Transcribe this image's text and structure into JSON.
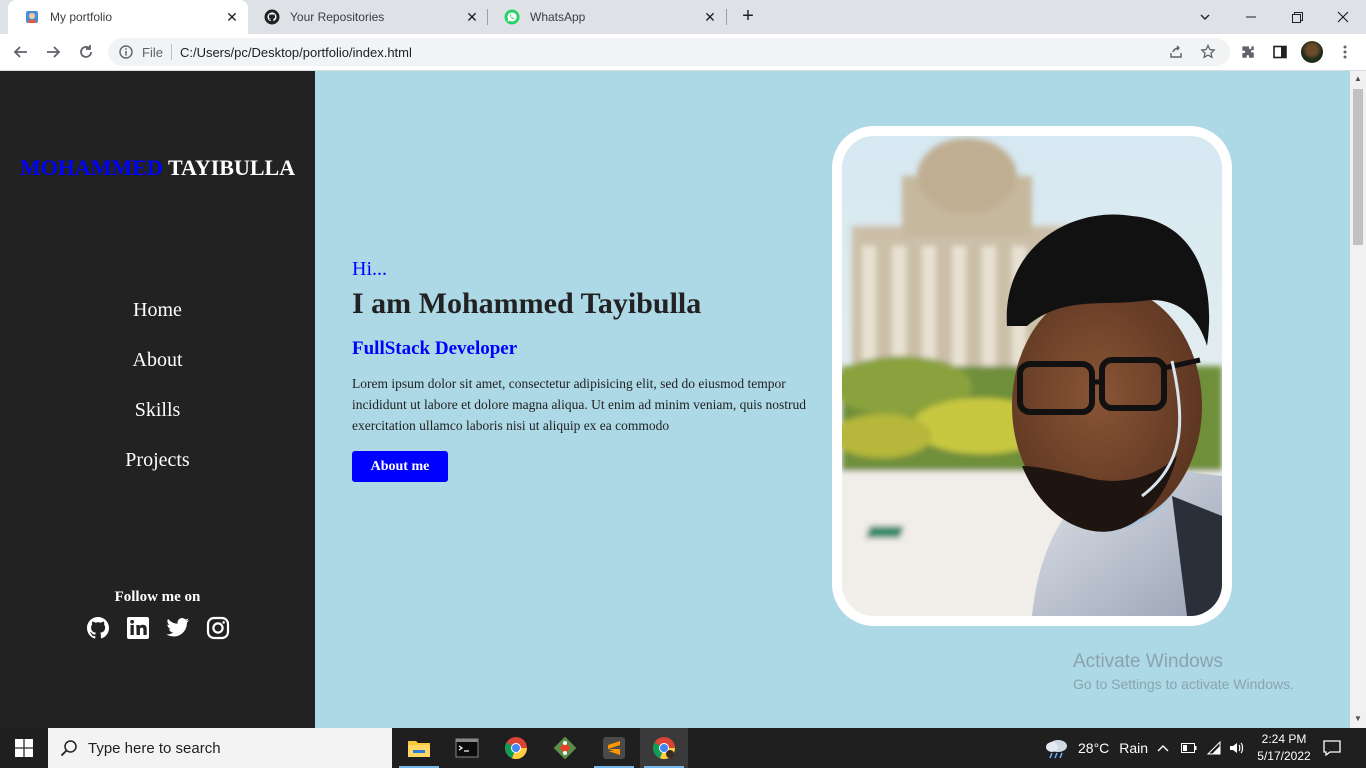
{
  "browser": {
    "tabs": [
      {
        "title": "My portfolio",
        "icon": "portfolio-favicon",
        "active": true
      },
      {
        "title": "Your Repositories",
        "icon": "github-favicon",
        "active": false
      },
      {
        "title": "WhatsApp",
        "icon": "whatsapp-favicon",
        "active": false
      }
    ],
    "address": {
      "scheme_label": "File",
      "url": "C:/Users/pc/Desktop/portfolio/index.html"
    }
  },
  "sidebar": {
    "brand_first": "MOHAMMED",
    "brand_last": "TAYIBULLA",
    "nav": [
      {
        "label": "Home"
      },
      {
        "label": "About"
      },
      {
        "label": "Skills"
      },
      {
        "label": "Projects"
      }
    ],
    "follow_label": "Follow me on",
    "socials": [
      "github-icon",
      "linkedin-icon",
      "twitter-icon",
      "instagram-icon"
    ]
  },
  "hero": {
    "greeting": "Hi...",
    "headline": "I am Mohammed Tayibulla",
    "role": "FullStack Developer",
    "description": "Lorem ipsum dolor sit amet, consectetur adipisicing elit, sed do eiusmod tempor incididunt ut labore et dolore magna aliqua. Ut enim ad minim veniam, quis nostrud exercitation ullamco laboris nisi ut aliquip ex ea commodo",
    "button_label": "About me"
  },
  "watermark": {
    "line1": "Activate Windows",
    "line2": "Go to Settings to activate Windows."
  },
  "taskbar": {
    "search_placeholder": "Type here to search",
    "weather_temp": "28°C",
    "weather_text": "Rain",
    "time": "2:24 PM",
    "date": "5/17/2022"
  },
  "colors": {
    "page_bg": "#add8e6",
    "sidebar_bg": "#222222",
    "accent": "#0000ff"
  }
}
